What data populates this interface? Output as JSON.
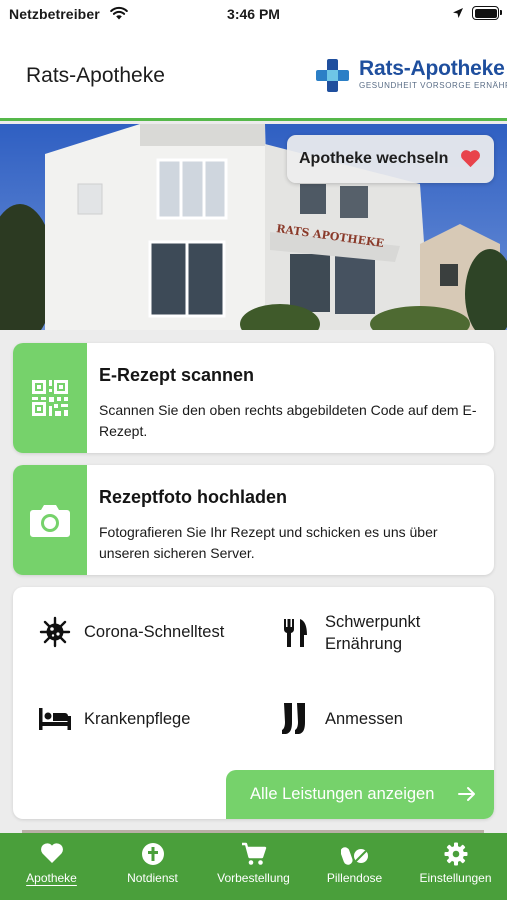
{
  "status_bar": {
    "carrier": "Netzbetreiber",
    "time": "3:46 PM"
  },
  "header": {
    "title": "Rats-Apotheke",
    "logo": {
      "name_part1": "Rats-",
      "name_part2": "Apotheke",
      "tagline": "GESUNDHEIT VORSORGE ERNÄHRUNG"
    }
  },
  "hero": {
    "switch_label": "Apotheke wechseln",
    "building_sign": "RATS APOTHEKE"
  },
  "cards": [
    {
      "title": "E-Rezept scannen",
      "description": "Scannen Sie den oben rechts abgebildeten Code auf dem E-Rezept.",
      "icon": "qr-code-icon"
    },
    {
      "title": "Rezeptfoto hochladen",
      "description": "Fotografieren Sie Ihr Rezept und schicken es uns über unseren sicheren Server.",
      "icon": "camera-icon"
    }
  ],
  "services": {
    "items": [
      {
        "label": "Corona-Schnelltest",
        "icon": "virus-icon"
      },
      {
        "label": "Schwerpunkt Ernährung",
        "icon": "cutlery-icon"
      },
      {
        "label": "Krankenpflege",
        "icon": "bed-icon"
      },
      {
        "label": "Anmessen",
        "icon": "stockings-icon"
      }
    ],
    "all_label": "Alle Leistungen anzeigen"
  },
  "tabs": [
    {
      "label": "Apotheke",
      "icon": "heart-icon",
      "active": true
    },
    {
      "label": "Notdienst",
      "icon": "emergency-icon",
      "active": false
    },
    {
      "label": "Vorbestellung",
      "icon": "cart-icon",
      "active": false
    },
    {
      "label": "Pillendose",
      "icon": "pills-icon",
      "active": false
    },
    {
      "label": "Einstellungen",
      "icon": "gear-icon",
      "active": false
    }
  ],
  "colors": {
    "accent": "#76d26b",
    "tabbar": "#4a9f3b",
    "brand_blue": "#1f4f9e",
    "heart": "#e8434b"
  }
}
